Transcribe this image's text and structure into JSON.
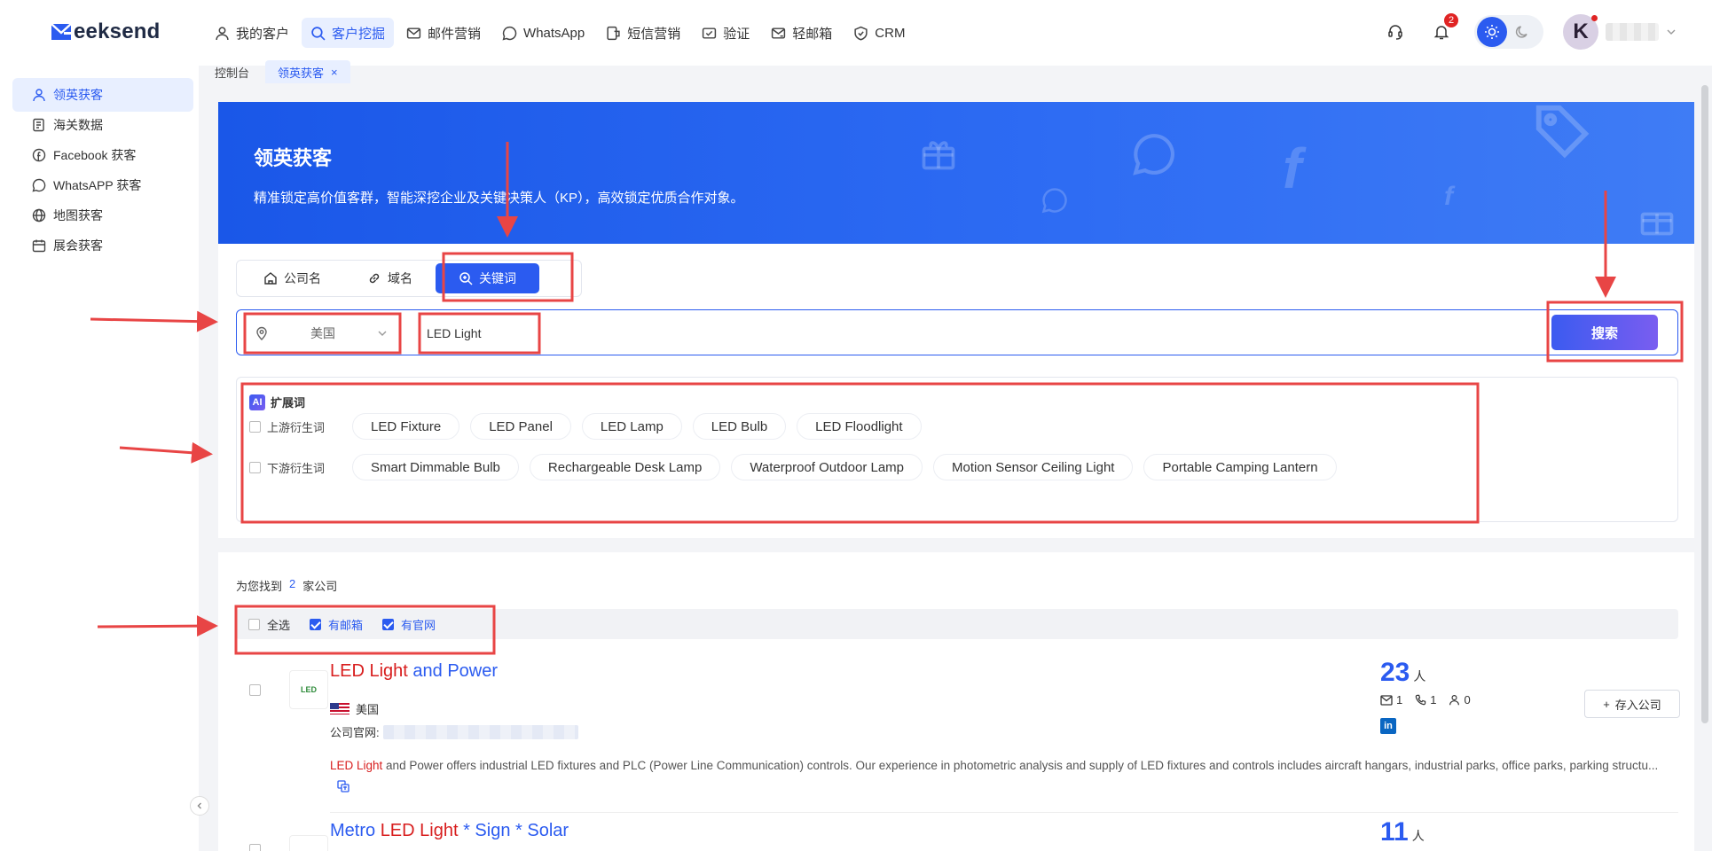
{
  "app": {
    "logo_text": "eeksend",
    "nav": [
      {
        "label": "我的客户",
        "icon": "user-icon"
      },
      {
        "label": "客户挖掘",
        "icon": "search-icon",
        "active": true
      },
      {
        "label": "邮件营销",
        "icon": "mail-icon"
      },
      {
        "label": "WhatsApp",
        "icon": "whatsapp-icon"
      },
      {
        "label": "短信营销",
        "icon": "sms-icon"
      },
      {
        "label": "验证",
        "icon": "verify-icon"
      },
      {
        "label": "轻邮箱",
        "icon": "mailbox-icon"
      },
      {
        "label": "CRM",
        "icon": "crm-icon"
      }
    ],
    "notifications_count": "2",
    "avatar_letter": "K"
  },
  "tabs": [
    {
      "label": "控制台"
    },
    {
      "label": "领英获客",
      "active": true,
      "close": "×"
    }
  ],
  "sidebar": {
    "items": [
      {
        "label": "领英获客",
        "icon": "linkedin-user-icon",
        "active": true
      },
      {
        "label": "海关数据",
        "icon": "customs-icon"
      },
      {
        "label": "Facebook 获客",
        "icon": "facebook-icon"
      },
      {
        "label": "WhatsAPP 获客",
        "icon": "whatsapp-icon"
      },
      {
        "label": "地图获客",
        "icon": "globe-icon"
      },
      {
        "label": "展会获客",
        "icon": "calendar-icon"
      }
    ]
  },
  "hero": {
    "title": "领英获客",
    "subtitle": "精准锁定高价值客群，智能深挖企业及关键决策人（KP），高效锁定优质合作对象。"
  },
  "search": {
    "modes": [
      {
        "label": "公司名",
        "icon": "building-icon"
      },
      {
        "label": "域名",
        "icon": "link-icon"
      },
      {
        "label": "关键词",
        "icon": "keyword-search-icon",
        "active": true
      }
    ],
    "country": "美国",
    "keyword": "LED Light",
    "button": "搜索"
  },
  "expansion": {
    "ai_badge": "AI",
    "title": "扩展词",
    "upstream_label": "上游衍生词",
    "upstream": [
      "LED Fixture",
      "LED Panel",
      "LED Lamp",
      "LED Bulb",
      "LED Floodlight"
    ],
    "downstream_label": "下游衍生词",
    "downstream": [
      "Smart Dimmable Bulb",
      "Rechargeable Desk Lamp",
      "Waterproof Outdoor Lamp",
      "Motion Sensor Ceiling Light",
      "Portable Camping Lantern"
    ]
  },
  "results": {
    "found_prefix": "为您找到",
    "found_count": "2",
    "found_suffix": "家公司",
    "filters": [
      {
        "label": "全选",
        "checked": false
      },
      {
        "label": "有邮箱",
        "checked": true
      },
      {
        "label": "有官网",
        "checked": true
      }
    ],
    "companies": [
      {
        "name_hl": "LED Light",
        "name_rest": " and Power",
        "logo_text": "LED",
        "country": "美国",
        "site_label": "公司官网:",
        "desc_hl": "LED Light",
        "desc_rest": " and Power offers industrial LED fixtures and PLC (Power Line Communication) controls. Our experience in photometric analysis and supply of LED fixtures and controls includes aircraft hangars, industrial parks, office parks, parking structu...",
        "people": "23",
        "people_unit": "人",
        "emails": "1",
        "phones": "1",
        "contacts": "0",
        "save_label": "存入公司",
        "save_plus": "+"
      },
      {
        "name_pre": "Metro ",
        "name_hl": "LED Light",
        "name_rest": " * Sign * Solar",
        "people": "11",
        "people_unit": "人"
      }
    ]
  },
  "colors": {
    "accent": "#2b5bf0",
    "highlight": "#d81e1e",
    "annotation": "#e84545"
  }
}
